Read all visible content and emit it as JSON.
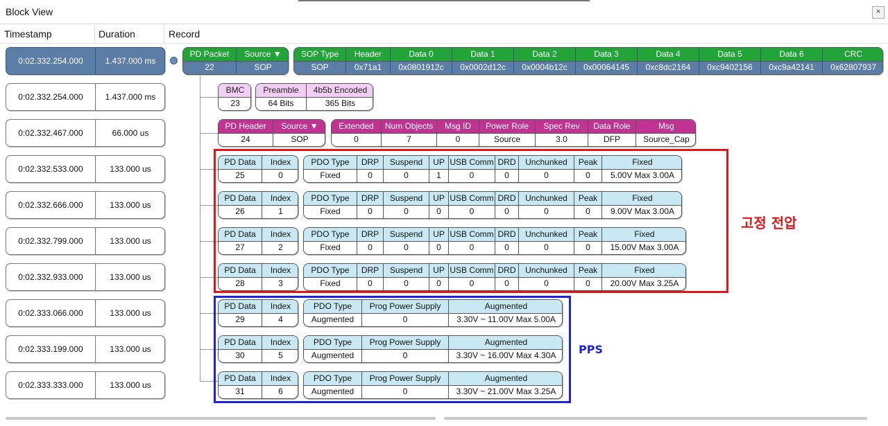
{
  "window": {
    "title": "Block View",
    "close": "×"
  },
  "columns": {
    "timestamp": "Timestamp",
    "duration": "Duration",
    "record": "Record"
  },
  "rows": [
    {
      "timestamp": "0:02.332.254.000",
      "duration": "1.437.000 ms"
    },
    {
      "timestamp": "0:02.332.254.000",
      "duration": "1.437.000 ms"
    },
    {
      "timestamp": "0:02.332.467.000",
      "duration": "66.000 us"
    },
    {
      "timestamp": "0:02.332.533.000",
      "duration": "133.000 us"
    },
    {
      "timestamp": "0:02.332.666.000",
      "duration": "133.000 us"
    },
    {
      "timestamp": "0:02.332.799.000",
      "duration": "133.000 us"
    },
    {
      "timestamp": "0:02.332.933.000",
      "duration": "133.000 us"
    },
    {
      "timestamp": "0:02.333.066.000",
      "duration": "133.000 us"
    },
    {
      "timestamp": "0:02.333.199.000",
      "duration": "133.000 us"
    },
    {
      "timestamp": "0:02.333.333.000",
      "duration": "133.000 us"
    }
  ],
  "packet": {
    "pd_packet": [
      [
        "PD Packet",
        "22"
      ],
      [
        "Source ▼",
        "SOP"
      ]
    ],
    "sop": [
      [
        "SOP Type",
        "SOP"
      ],
      [
        "Header",
        "0x71a1"
      ],
      [
        "Data 0",
        "0x0801912c"
      ],
      [
        "Data 1",
        "0x0002d12c"
      ],
      [
        "Data 2",
        "0x0004b12c"
      ],
      [
        "Data 3",
        "0x00064145"
      ],
      [
        "Data 4",
        "0xc8dc2164"
      ],
      [
        "Data 5",
        "0xc9402156"
      ],
      [
        "Data 6",
        "0xc9a42141"
      ],
      [
        "CRC",
        "0x62807937"
      ]
    ]
  },
  "bmc": {
    "bmc": [
      [
        "BMC",
        "23"
      ]
    ],
    "preamble": [
      [
        "Preamble",
        "64 Bits"
      ],
      [
        "4b5b Encoded",
        "365 Bits"
      ]
    ]
  },
  "pd_header": {
    "left": [
      [
        "PD Header",
        "24"
      ],
      [
        "Source ▼",
        "SOP"
      ]
    ],
    "right": [
      [
        "Extended",
        "0"
      ],
      [
        "Num Objects",
        "7"
      ],
      [
        "Msg ID",
        "0"
      ],
      [
        "Power Role",
        "Source"
      ],
      [
        "Spec Rev",
        "3.0"
      ],
      [
        "Data Role",
        "DFP"
      ],
      [
        "Msg",
        "Source_Cap"
      ]
    ]
  },
  "fixed_pdos": [
    {
      "pd": [
        [
          "PD Data",
          "25"
        ],
        [
          "Index",
          "0"
        ]
      ],
      "fields": [
        [
          "PDO Type",
          "Fixed"
        ],
        [
          "DRP",
          "0"
        ],
        [
          "Suspend",
          "0"
        ],
        [
          "UP",
          "1"
        ],
        [
          "USB Comm",
          "0"
        ],
        [
          "DRD",
          "0"
        ],
        [
          "Unchunked",
          "0"
        ],
        [
          "Peak",
          "0"
        ],
        [
          "Fixed",
          "5.00V Max 3.00A"
        ]
      ]
    },
    {
      "pd": [
        [
          "PD Data",
          "26"
        ],
        [
          "Index",
          "1"
        ]
      ],
      "fields": [
        [
          "PDO Type",
          "Fixed"
        ],
        [
          "DRP",
          "0"
        ],
        [
          "Suspend",
          "0"
        ],
        [
          "UP",
          "0"
        ],
        [
          "USB Comm",
          "0"
        ],
        [
          "DRD",
          "0"
        ],
        [
          "Unchunked",
          "0"
        ],
        [
          "Peak",
          "0"
        ],
        [
          "Fixed",
          "9.00V Max 3.00A"
        ]
      ]
    },
    {
      "pd": [
        [
          "PD Data",
          "27"
        ],
        [
          "Index",
          "2"
        ]
      ],
      "fields": [
        [
          "PDO Type",
          "Fixed"
        ],
        [
          "DRP",
          "0"
        ],
        [
          "Suspend",
          "0"
        ],
        [
          "UP",
          "0"
        ],
        [
          "USB Comm",
          "0"
        ],
        [
          "DRD",
          "0"
        ],
        [
          "Unchunked",
          "0"
        ],
        [
          "Peak",
          "0"
        ],
        [
          "Fixed",
          "15.00V Max 3.00A"
        ]
      ]
    },
    {
      "pd": [
        [
          "PD Data",
          "28"
        ],
        [
          "Index",
          "3"
        ]
      ],
      "fields": [
        [
          "PDO Type",
          "Fixed"
        ],
        [
          "DRP",
          "0"
        ],
        [
          "Suspend",
          "0"
        ],
        [
          "UP",
          "0"
        ],
        [
          "USB Comm",
          "0"
        ],
        [
          "DRD",
          "0"
        ],
        [
          "Unchunked",
          "0"
        ],
        [
          "Peak",
          "0"
        ],
        [
          "Fixed",
          "20.00V Max 3.25A"
        ]
      ]
    }
  ],
  "pps_pdos": [
    {
      "pd": [
        [
          "PD Data",
          "29"
        ],
        [
          "Index",
          "4"
        ]
      ],
      "fields": [
        [
          "PDO Type",
          "Augmented"
        ],
        [
          "Prog Power Supply",
          "0"
        ],
        [
          "Augmented",
          "3.30V ~ 11.00V Max 5.00A"
        ]
      ]
    },
    {
      "pd": [
        [
          "PD Data",
          "30"
        ],
        [
          "Index",
          "5"
        ]
      ],
      "fields": [
        [
          "PDO Type",
          "Augmented"
        ],
        [
          "Prog Power Supply",
          "0"
        ],
        [
          "Augmented",
          "3.30V ~ 16.00V Max 4.30A"
        ]
      ]
    },
    {
      "pd": [
        [
          "PD Data",
          "31"
        ],
        [
          "Index",
          "6"
        ]
      ],
      "fields": [
        [
          "PDO Type",
          "Augmented"
        ],
        [
          "Prog Power Supply",
          "0"
        ],
        [
          "Augmented",
          "3.30V ~ 21.00V Max 3.25A"
        ]
      ]
    }
  ],
  "annotations": {
    "fixed_label": "고정 전압",
    "pps_label": "PPS"
  },
  "colors": {
    "green": "#23a438",
    "magenta": "#c03393",
    "pink": "#f2cdf4",
    "cyan": "#c8e8f4",
    "selected": "#5b7ea6",
    "red_box": "#e0161b",
    "blue_box": "#1f22d8"
  }
}
